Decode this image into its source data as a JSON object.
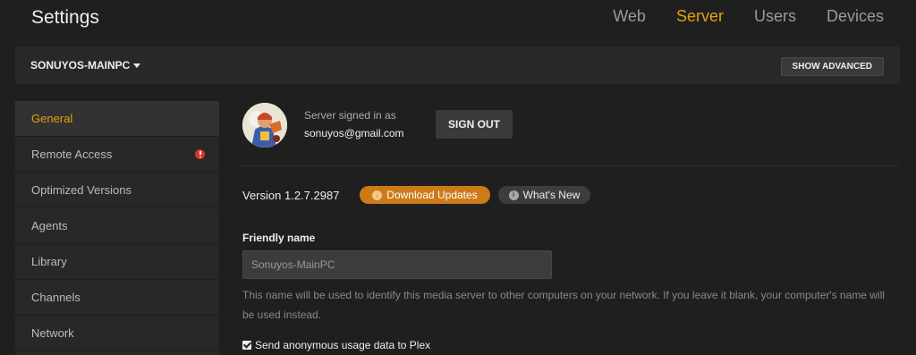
{
  "header": {
    "title": "Settings",
    "tabs": [
      {
        "label": "Web",
        "active": false
      },
      {
        "label": "Server",
        "active": true
      },
      {
        "label": "Users",
        "active": false
      },
      {
        "label": "Devices",
        "active": false
      }
    ]
  },
  "server_bar": {
    "server_name": "SONUYOS-MAINPC",
    "show_advanced_label": "SHOW ADVANCED"
  },
  "sidebar": {
    "items": [
      {
        "label": "General",
        "active": true
      },
      {
        "label": "Remote Access",
        "alert": true
      },
      {
        "label": "Optimized Versions"
      },
      {
        "label": "Agents"
      },
      {
        "label": "Library"
      },
      {
        "label": "Channels"
      },
      {
        "label": "Network"
      }
    ]
  },
  "account": {
    "signed_in_label": "Server signed in as",
    "email": "sonuyos@gmail.com",
    "sign_out_label": "SIGN OUT"
  },
  "version": {
    "text": "Version 1.2.7.2987",
    "download_updates_label": "Download Updates",
    "whats_new_label": "What's New"
  },
  "friendly_name": {
    "label": "Friendly name",
    "value": "Sonuyos-MainPC",
    "help": "This name will be used to identify this media server to other computers on your network. If you leave it blank, your computer's name will be used instead."
  },
  "usage_data": {
    "label": "Send anonymous usage data to Plex",
    "checked": true
  },
  "colors": {
    "accent": "#e5a00d",
    "download_button": "#cc7b19",
    "alert": "#d9352a",
    "background": "#1f1f1f",
    "panel": "#282828"
  },
  "icons": [
    "caret-down-icon",
    "alert-icon",
    "download-icon",
    "info-icon",
    "checkbox-checked-icon"
  ]
}
